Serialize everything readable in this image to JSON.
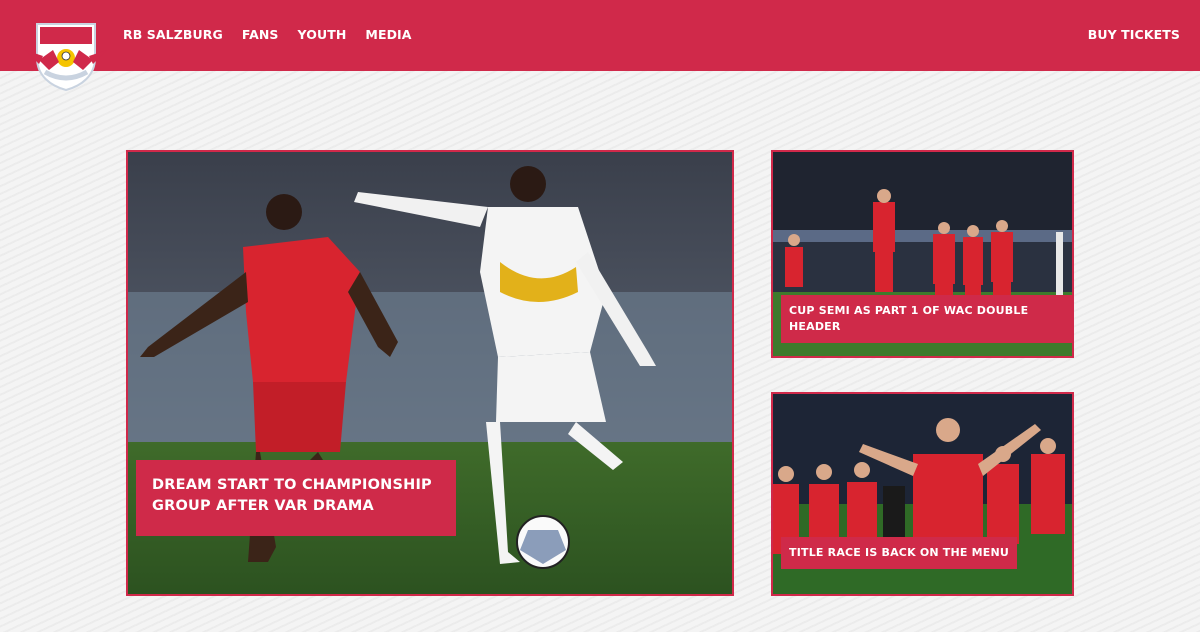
{
  "header": {
    "logo": {
      "wordmark_top": "RedBull",
      "wordmark_bottom": "SALZBURG"
    },
    "nav": [
      "RB SALZBURG",
      "FANS",
      "YOUTH",
      "MEDIA"
    ],
    "cta": "BUY TICKETS"
  },
  "colors": {
    "brand_red": "#d0294a",
    "caption_bg": "#cf2a49",
    "background": "#f4f4f4"
  },
  "stories": [
    {
      "headline": "DREAM START TO CHAMPIONSHIP GROUP AFTER VAR DRAMA"
    },
    {
      "headline": "CUP SEMI AS PART 1 OF WAC DOUBLE HEADER"
    },
    {
      "headline": "TITLE RACE IS BACK ON THE MENU"
    }
  ]
}
